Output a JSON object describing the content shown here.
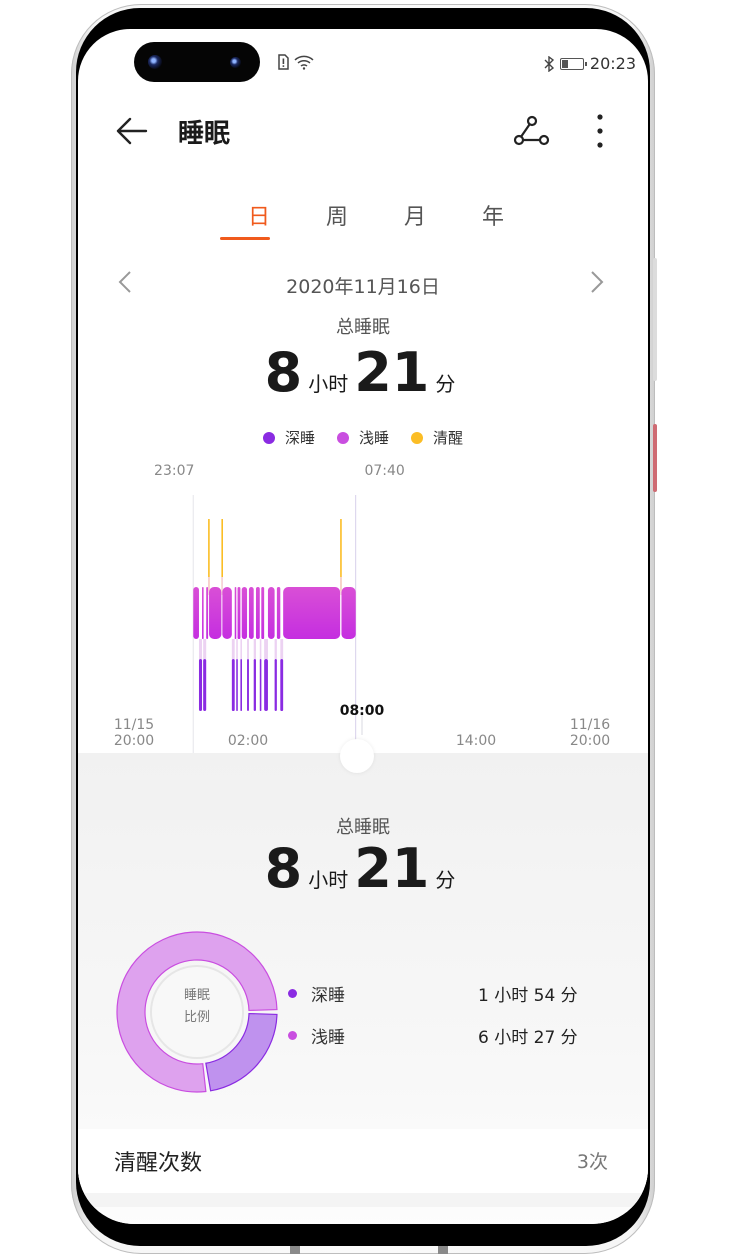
{
  "status_bar": {
    "time": "20:23",
    "left_icons": [
      "sim-alert-icon",
      "wifi-icon"
    ],
    "right_icons": [
      "bluetooth-icon",
      "battery-icon"
    ],
    "battery_level": 0.3
  },
  "header": {
    "title": "睡眠",
    "back_icon": "arrow-left-icon",
    "share_icon": "share-icon",
    "more_icon": "more-vertical-icon"
  },
  "tabs": [
    {
      "label": "日",
      "active": true
    },
    {
      "label": "周",
      "active": false
    },
    {
      "label": "月",
      "active": false
    },
    {
      "label": "年",
      "active": false
    }
  ],
  "date_nav": {
    "prev": "‹",
    "next": "›",
    "date": "2020年11月16日"
  },
  "summary": {
    "label": "总睡眠",
    "hours": "8",
    "hours_unit": "小时",
    "minutes": "21",
    "minutes_unit": "分"
  },
  "legend": [
    {
      "label": "深睡",
      "color": "#8a2be2"
    },
    {
      "label": "浅睡",
      "color": "#c94ee0"
    },
    {
      "label": "清醒",
      "color": "#fbbd25"
    }
  ],
  "chart_data": {
    "type": "hypnogram",
    "title": "",
    "x_axis": {
      "start": "11/15 20:00",
      "end": "11/16 20:00",
      "ticks": [
        {
          "label": "11/15\n20:00",
          "hour": 0
        },
        {
          "label": "02:00",
          "hour": 6
        },
        {
          "label": "08:00",
          "hour": 12,
          "highlight": true
        },
        {
          "label": "14:00",
          "hour": 18
        },
        {
          "label": "11/16\n20:00",
          "hour": 24
        }
      ]
    },
    "sleep_start_label": "23:07",
    "sleep_end_label": "07:40",
    "sleep_start_hour": 3.117,
    "sleep_end_hour": 11.667,
    "levels": [
      "清醒",
      "浅睡",
      "深睡"
    ],
    "segments": [
      {
        "stage": "light",
        "start": 3.12,
        "end": 3.42
      },
      {
        "stage": "deep",
        "start": 3.42,
        "end": 3.58
      },
      {
        "stage": "light",
        "start": 3.58,
        "end": 3.64
      },
      {
        "stage": "deep",
        "start": 3.64,
        "end": 3.8
      },
      {
        "stage": "light",
        "start": 3.8,
        "end": 3.9
      },
      {
        "stage": "awake",
        "start": 3.9,
        "end": 3.95
      },
      {
        "stage": "light",
        "start": 3.95,
        "end": 4.6
      },
      {
        "stage": "awake",
        "start": 4.6,
        "end": 4.65
      },
      {
        "stage": "light",
        "start": 4.65,
        "end": 5.15
      },
      {
        "stage": "deep",
        "start": 5.15,
        "end": 5.3
      },
      {
        "stage": "light",
        "start": 5.3,
        "end": 5.38
      },
      {
        "stage": "deep",
        "start": 5.38,
        "end": 5.45
      },
      {
        "stage": "light",
        "start": 5.45,
        "end": 5.6
      },
      {
        "stage": "deep",
        "start": 5.6,
        "end": 5.67
      },
      {
        "stage": "light",
        "start": 5.67,
        "end": 5.95
      },
      {
        "stage": "deep",
        "start": 5.95,
        "end": 6.05
      },
      {
        "stage": "light",
        "start": 6.05,
        "end": 6.3
      },
      {
        "stage": "deep",
        "start": 6.3,
        "end": 6.42
      },
      {
        "stage": "light",
        "start": 6.42,
        "end": 6.62
      },
      {
        "stage": "deep",
        "start": 6.62,
        "end": 6.7
      },
      {
        "stage": "light",
        "start": 6.7,
        "end": 6.85
      },
      {
        "stage": "deep",
        "start": 6.85,
        "end": 7.05
      },
      {
        "stage": "light",
        "start": 7.05,
        "end": 7.4
      },
      {
        "stage": "deep",
        "start": 7.4,
        "end": 7.52
      },
      {
        "stage": "light",
        "start": 7.52,
        "end": 7.7
      },
      {
        "stage": "deep",
        "start": 7.7,
        "end": 7.85
      },
      {
        "stage": "light",
        "start": 7.85,
        "end": 10.85
      },
      {
        "stage": "awake",
        "start": 10.85,
        "end": 10.92
      },
      {
        "stage": "light",
        "start": 10.92,
        "end": 11.67
      }
    ],
    "colors": {
      "deep": "#8a2be2",
      "light": "#cc3dd8",
      "awake": "#fbbd25"
    }
  },
  "details": {
    "label": "总睡眠",
    "hours": "8",
    "hours_unit": "小时",
    "minutes": "21",
    "minutes_unit": "分",
    "donut_center": [
      "睡眠",
      "比例"
    ],
    "ratio": [
      {
        "label": "深睡",
        "value": "1 小时 54 分",
        "minutes": 114,
        "color": "#8a2be2",
        "fill": "#bf92ee"
      },
      {
        "label": "浅睡",
        "value": "6 小时 27 分",
        "minutes": 387,
        "color": "#c94ee0",
        "fill": "#dea2ee"
      }
    ]
  },
  "awake_count": {
    "label": "清醒次数",
    "value": "3次"
  }
}
